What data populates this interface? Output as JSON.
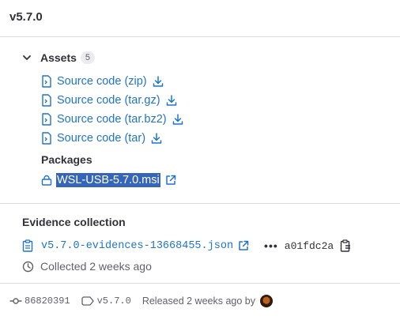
{
  "release": {
    "title": "v5.7.0"
  },
  "assets": {
    "label": "Assets",
    "count": "5",
    "sources": [
      {
        "label": "Source code (zip)"
      },
      {
        "label": "Source code (tar.gz)"
      },
      {
        "label": "Source code (tar.bz2)"
      },
      {
        "label": "Source code (tar)"
      }
    ],
    "packages_heading": "Packages",
    "package": {
      "label": "WSL-USB-5.7.0.msi"
    }
  },
  "evidence": {
    "heading": "Evidence collection",
    "file": "v5.7.0-evidences-13668455.json",
    "dots": "•••",
    "sha": "a01fdc2a",
    "collected": "Collected 2 weeks ago"
  },
  "footer": {
    "commit": "86820391",
    "tag": "v5.7.0",
    "released": "Released 2 weeks ago by"
  },
  "colors": {
    "link": "#1f75cb",
    "selection": "#3465b8",
    "divider": "#dcdcde"
  }
}
